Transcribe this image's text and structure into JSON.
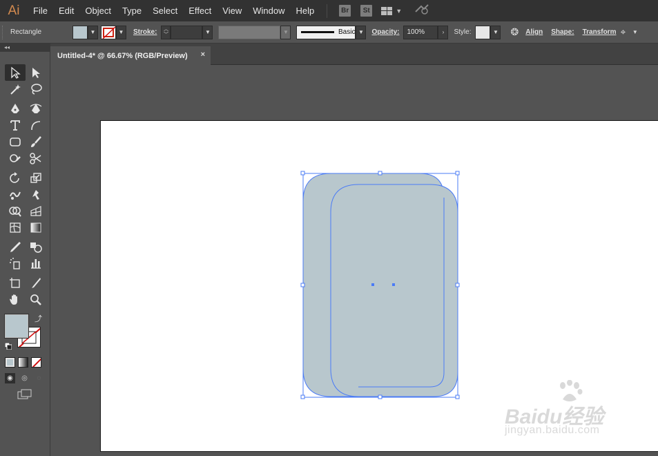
{
  "app": {
    "logo": "Ai",
    "menu": [
      "File",
      "Edit",
      "Object",
      "Type",
      "Select",
      "Effect",
      "View",
      "Window",
      "Help"
    ],
    "badges": [
      "Br",
      "St"
    ],
    "icons": {
      "workspace_switcher": "workspace-grid-icon",
      "gpu": "gpu-performance-icon"
    }
  },
  "control_bar": {
    "selection_label": "Rectangle",
    "fill_color": "#b8c7cd",
    "stroke_label": "Stroke:",
    "stroke_weight": "",
    "brush_label": "Basic",
    "opacity_label": "Opacity:",
    "opacity_value": "100%",
    "style_label": "Style:",
    "align_label": "Align",
    "shape_label": "Shape:",
    "transform_label": "Transform"
  },
  "document": {
    "tab_title": "Untitled-4* @ 66.67% (RGB/Preview)",
    "close_glyph": "×"
  },
  "tool_panel": {
    "collapse_glyph": "◂◂",
    "fill_color": "#b8c7cd",
    "stroke_color": "none",
    "tools": [
      [
        "selection-tool",
        "direct-selection-tool"
      ],
      [
        "magic-wand-tool",
        "lasso-tool"
      ],
      [
        "pen-tool",
        "curvature-tool"
      ],
      [
        "type-tool",
        "arc-tool"
      ],
      [
        "rectangle-tool",
        "paintbrush-tool"
      ],
      [
        "shaper-tool",
        "scissors-tool"
      ],
      [
        "rotate-tool",
        "scale-tool"
      ],
      [
        "warp-tool",
        "puppet-warp-tool"
      ],
      [
        "shape-builder-tool",
        "perspective-grid-tool"
      ],
      [
        "mesh-tool",
        "gradient-tool"
      ],
      [
        "eyedropper-tool",
        "blend-tool"
      ],
      [
        "symbol-sprayer-tool",
        "column-graph-tool"
      ],
      [
        "artboard-tool",
        "slice-tool"
      ],
      [
        "hand-tool",
        "zoom-tool"
      ]
    ]
  },
  "artwork": {
    "shape_fill": "#b8c7cd",
    "selection_color": "#4a7bf6"
  },
  "watermark": {
    "brand": "Baidu经验",
    "url": "jingyan.baidu.com"
  }
}
